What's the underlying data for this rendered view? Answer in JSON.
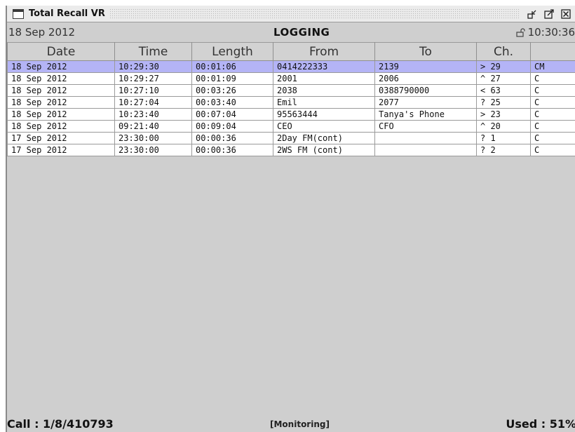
{
  "window": {
    "title": "Total Recall VR"
  },
  "infobar": {
    "date": "18 Sep 2012",
    "mode": "LOGGING",
    "time": "10:30:36"
  },
  "table": {
    "columns": [
      "Date",
      "Time",
      "Length",
      "From",
      "To",
      "Ch.",
      ""
    ],
    "rows": [
      {
        "date": "18 Sep 2012",
        "time": "10:29:30",
        "length": "00:01:06",
        "from": "0414222333",
        "to": "2139",
        "ch": "> 29",
        "flag": "CM"
      },
      {
        "date": "18 Sep 2012",
        "time": "10:29:27",
        "length": "00:01:09",
        "from": "2001",
        "to": "2006",
        "ch": "^ 27",
        "flag": "C"
      },
      {
        "date": "18 Sep 2012",
        "time": "10:27:10",
        "length": "00:03:26",
        "from": "2038",
        "to": "0388790000",
        "ch": "< 63",
        "flag": "C"
      },
      {
        "date": "18 Sep 2012",
        "time": "10:27:04",
        "length": "00:03:40",
        "from": "Emil",
        "to": "2077",
        "ch": "? 25",
        "flag": "C"
      },
      {
        "date": "18 Sep 2012",
        "time": "10:23:40",
        "length": "00:07:04",
        "from": "95563444",
        "to": "Tanya's Phone",
        "ch": "> 23",
        "flag": "C"
      },
      {
        "date": "18 Sep 2012",
        "time": "09:21:40",
        "length": "00:09:04",
        "from": "CEO",
        "to": "CFO",
        "ch": "^ 20",
        "flag": "C"
      },
      {
        "date": "17 Sep 2012",
        "time": "23:30:00",
        "length": "00:00:36",
        "from": "2Day FM(cont)",
        "to": "",
        "ch": "? 1",
        "flag": "C"
      },
      {
        "date": "17 Sep 2012",
        "time": "23:30:00",
        "length": "00:00:36",
        "from": "2WS FM (cont)",
        "to": "",
        "ch": "? 2",
        "flag": "C"
      }
    ]
  },
  "statusbar": {
    "call": "Call : 1/8/410793",
    "state": "[Monitoring]",
    "used": "Used : 51%"
  },
  "colors": {
    "selected_row": "#b4b4f6",
    "window_bg": "#cfcfcf"
  },
  "icons": [
    "window-menu-icon",
    "restore-icon",
    "maximize-icon",
    "close-icon",
    "lock-icon"
  ]
}
